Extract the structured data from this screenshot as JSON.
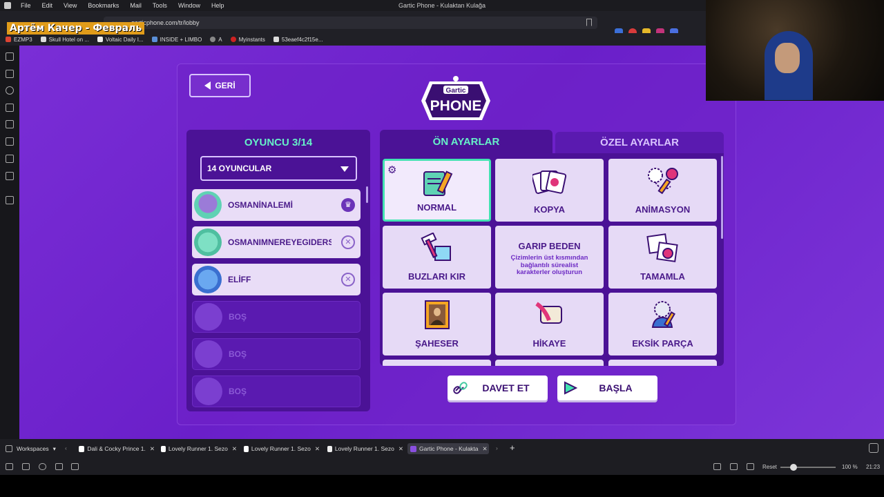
{
  "menubar": {
    "items": [
      "File",
      "Edit",
      "View",
      "Bookmarks",
      "Mail",
      "Tools",
      "Window",
      "Help"
    ],
    "window_title": "Gartic Phone - Kulaktan Kulağa"
  },
  "browser": {
    "url": "garticphone.com/tr/lobby",
    "bookmarks": [
      "EZMP3",
      "Skull Hotel on ...",
      "Voltaic Daily I...",
      "INSIDE + LIMBO",
      "A",
      "Myinstants",
      "53eaef4c2f15e..."
    ]
  },
  "stream_overlay": {
    "name": "Артём Качер - Февраль"
  },
  "lobby": {
    "back_label": "GERİ",
    "logo_small": "Gartic",
    "logo_big": "PHONE",
    "players_title": "OYUNCU 3/14",
    "player_count_select": "14 OYUNCULAR",
    "players": [
      {
        "name": "OSMANİNALEMİ",
        "status": "host"
      },
      {
        "name": "OSMANIMNEREYEGIDERSİN",
        "status": "kick"
      },
      {
        "name": "ELİFF",
        "status": "kick"
      },
      {
        "name": "BOŞ",
        "status": "empty"
      },
      {
        "name": "BOŞ",
        "status": "empty"
      },
      {
        "name": "BOŞ",
        "status": "empty"
      }
    ],
    "tabs": {
      "presets": "ÖN AYARLAR",
      "custom": "ÖZEL AYARLAR"
    },
    "modes": [
      {
        "label": "NORMAL",
        "selected": true
      },
      {
        "label": "KOPYA"
      },
      {
        "label": "ANİMASYON"
      },
      {
        "label": "BUZLARI KIR"
      },
      {
        "label": "GARIP BEDEN",
        "desc": "Çizimlerin üst kısmından bağlantılı sürealist karakterler oluşturun"
      },
      {
        "label": "TAMAMLA"
      },
      {
        "label": "ŞAHESER"
      },
      {
        "label": "HİKAYE"
      },
      {
        "label": "EKSİK PARÇA"
      }
    ],
    "invite_label": "DAVET ET",
    "start_label": "BAŞLA"
  },
  "tabbar": {
    "workspaces": "Workspaces",
    "tabs": [
      {
        "title": "Dali & Cocky Prince 1.",
        "active": false
      },
      {
        "title": "Lovely Runner 1. Sezo",
        "active": false
      },
      {
        "title": "Lovely Runner 1. Sezo",
        "active": false
      },
      {
        "title": "Lovely Runner 1. Sezo",
        "active": false
      },
      {
        "title": "Gartic Phone - Kulakta",
        "active": true
      }
    ]
  },
  "statusbar": {
    "reset": "Reset",
    "zoom": "100 %",
    "time": "21:23"
  },
  "colors": {
    "accent": "#66f0c8",
    "panel": "#4b1296",
    "bg": "#7a2ed6"
  }
}
